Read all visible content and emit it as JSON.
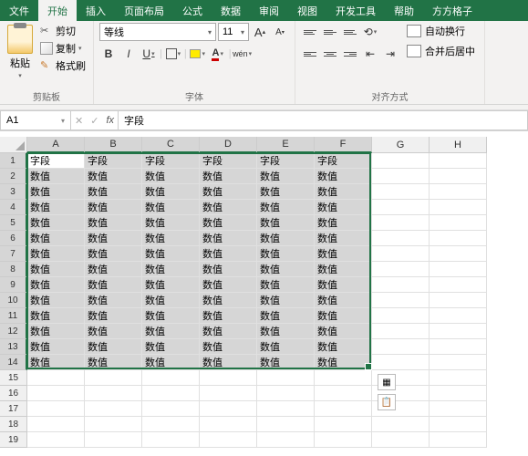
{
  "menu": {
    "items": [
      "文件",
      "开始",
      "插入",
      "页面布局",
      "公式",
      "数据",
      "审阅",
      "视图",
      "开发工具",
      "帮助",
      "方方格子"
    ],
    "active_index": 1
  },
  "ribbon": {
    "clipboard": {
      "paste": "粘贴",
      "cut": "剪切",
      "copy": "复制",
      "format_painter": "格式刷",
      "label": "剪贴板"
    },
    "font": {
      "name": "等线",
      "size": "11",
      "bold": "B",
      "italic": "I",
      "underline": "U",
      "font_a": "A",
      "wen": "wén",
      "label": "字体"
    },
    "align": {
      "wrap": "自动换行",
      "merge": "合并后居中",
      "label": "对齐方式"
    }
  },
  "formula_bar": {
    "name_box": "A1",
    "fx": "fx",
    "value": "字段"
  },
  "columns": [
    "A",
    "B",
    "C",
    "D",
    "E",
    "F",
    "G",
    "H"
  ],
  "sel_cols": 6,
  "sel_rows": 14,
  "row_count": 19,
  "header_text": "字段",
  "value_text": "数值",
  "chart_data": {
    "type": "table",
    "columns": [
      "A",
      "B",
      "C",
      "D",
      "E",
      "F"
    ],
    "data": [
      [
        "字段",
        "字段",
        "字段",
        "字段",
        "字段",
        "字段"
      ],
      [
        "数值",
        "数值",
        "数值",
        "数值",
        "数值",
        "数值"
      ],
      [
        "数值",
        "数值",
        "数值",
        "数值",
        "数值",
        "数值"
      ],
      [
        "数值",
        "数值",
        "数值",
        "数值",
        "数值",
        "数值"
      ],
      [
        "数值",
        "数值",
        "数值",
        "数值",
        "数值",
        "数值"
      ],
      [
        "数值",
        "数值",
        "数值",
        "数值",
        "数值",
        "数值"
      ],
      [
        "数值",
        "数值",
        "数值",
        "数值",
        "数值",
        "数值"
      ],
      [
        "数值",
        "数值",
        "数值",
        "数值",
        "数值",
        "数值"
      ],
      [
        "数值",
        "数值",
        "数值",
        "数值",
        "数值",
        "数值"
      ],
      [
        "数值",
        "数值",
        "数值",
        "数值",
        "数值",
        "数值"
      ],
      [
        "数值",
        "数值",
        "数值",
        "数值",
        "数值",
        "数值"
      ],
      [
        "数值",
        "数值",
        "数值",
        "数值",
        "数值",
        "数值"
      ],
      [
        "数值",
        "数值",
        "数值",
        "数值",
        "数值",
        "数值"
      ],
      [
        "数值",
        "数值",
        "数值",
        "数值",
        "数值",
        "数值"
      ]
    ]
  }
}
